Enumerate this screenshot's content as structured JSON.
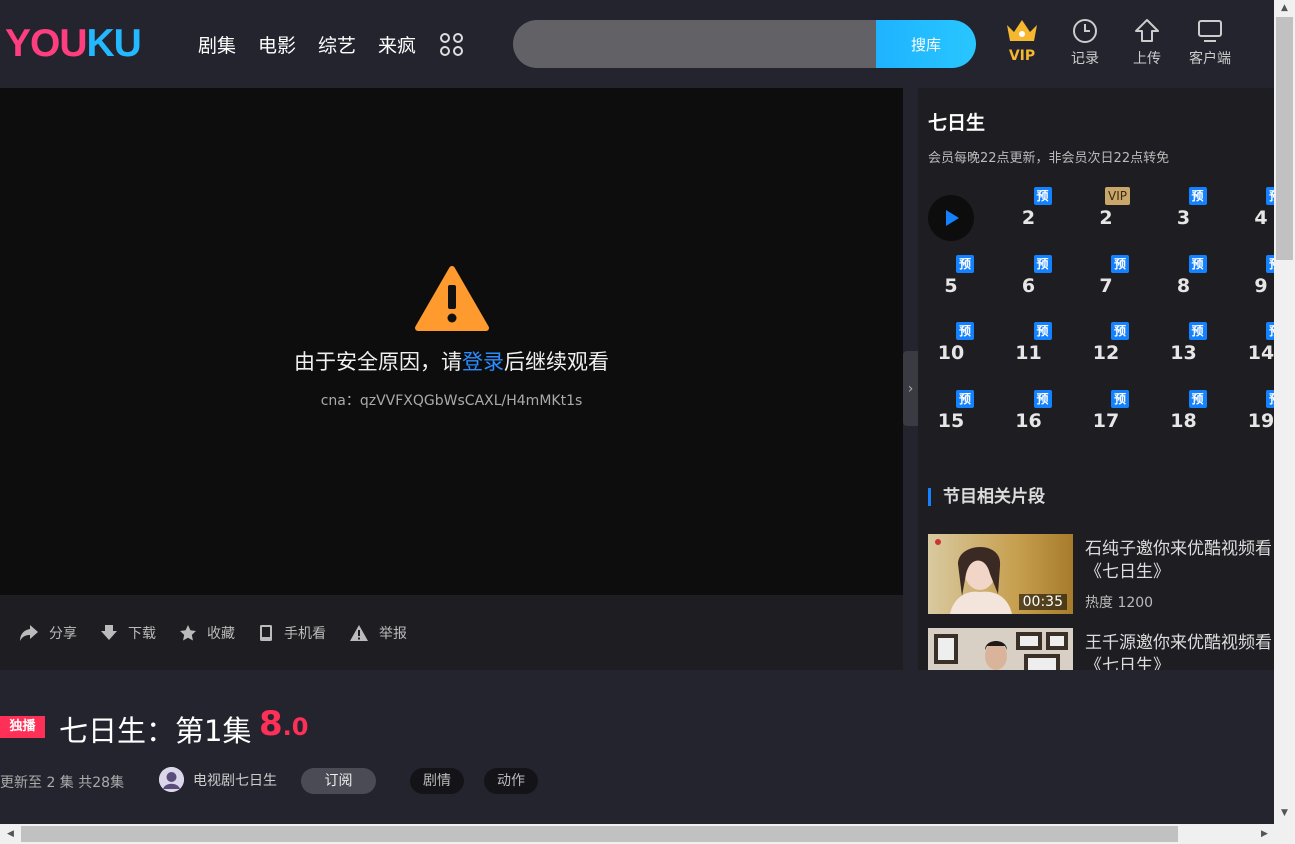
{
  "header": {
    "logo_you": "YOU",
    "logo_ku": "KU",
    "nav": [
      "剧集",
      "电影",
      "综艺",
      "来疯"
    ],
    "search_placeholder": "",
    "search_button": "搜库",
    "vip": "VIP",
    "history": "记录",
    "upload": "上传",
    "client": "客户端"
  },
  "player": {
    "message_prefix": "由于安全原因，请",
    "message_login": "登录",
    "message_suffix": "后继续观看",
    "cna": "cna：qzVVFXQGbWsCAXL/H4mMKt1s"
  },
  "actions": [
    "分享",
    "下载",
    "收藏",
    "手机看",
    "举报"
  ],
  "sidebar": {
    "title": "七日生",
    "subtitle": "会员每晚22点更新，非会员次日22点转免",
    "episodes": [
      {
        "num": "",
        "badge": "",
        "playing": true
      },
      {
        "num": "2",
        "badge": "预"
      },
      {
        "num": "2",
        "badge": "VIP"
      },
      {
        "num": "3",
        "badge": "预"
      },
      {
        "num": "4",
        "badge": "预"
      },
      {
        "num": "5",
        "badge": "预"
      },
      {
        "num": "6",
        "badge": "预"
      },
      {
        "num": "7",
        "badge": "预"
      },
      {
        "num": "8",
        "badge": "预"
      },
      {
        "num": "9",
        "badge": "预"
      },
      {
        "num": "10",
        "badge": "预"
      },
      {
        "num": "11",
        "badge": "预"
      },
      {
        "num": "12",
        "badge": "预"
      },
      {
        "num": "13",
        "badge": "预"
      },
      {
        "num": "14",
        "badge": "预"
      },
      {
        "num": "15",
        "badge": "预"
      },
      {
        "num": "16",
        "badge": "预"
      },
      {
        "num": "17",
        "badge": "预"
      },
      {
        "num": "18",
        "badge": "预"
      },
      {
        "num": "19",
        "badge": "预"
      }
    ],
    "related_title": "节目相关片段",
    "clips": [
      {
        "title": "石纯子邀你来优酷视频看《七日生》",
        "duration": "00:35",
        "heat": "热度 1200"
      },
      {
        "title": "王千源邀你来优酷视频看《七日生》",
        "duration": "",
        "heat": ""
      }
    ]
  },
  "info": {
    "exclusive": "独播",
    "title": "七日生：第1集",
    "score_int": "8",
    "score_dec": ".0",
    "meta": "更新至 2 集 共28集",
    "channel": "电视剧七日生",
    "subscribe": "订阅",
    "tags": [
      "剧情",
      "动作"
    ]
  },
  "colors": {
    "accent_blue": "#1481ff",
    "brand_pink": "#ff3e7f",
    "score_red": "#ff3057",
    "vip_gold": "#f5b82e"
  }
}
